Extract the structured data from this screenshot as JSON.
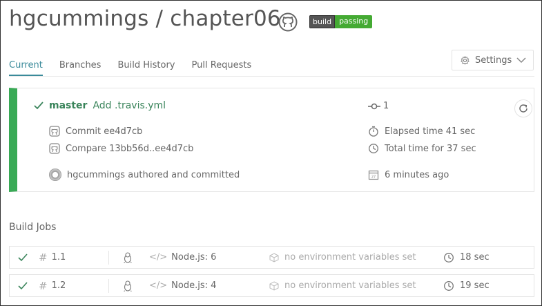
{
  "header": {
    "title": "hgcummings / chapter06",
    "badge_left": "build",
    "badge_right": "passing"
  },
  "tabs": [
    {
      "label": "Current",
      "active": true
    },
    {
      "label": "Branches",
      "active": false
    },
    {
      "label": "Build History",
      "active": false
    },
    {
      "label": "Pull Requests",
      "active": false
    }
  ],
  "settings_label": "Settings",
  "build": {
    "branch": "master",
    "message": "Add .travis.yml",
    "number": "1",
    "commit": "Commit ee4d7cb",
    "compare": "Compare 13bb56d..ee4d7cb",
    "author": "hgcummings authored and committed",
    "elapsed": "Elapsed time 41 sec",
    "total": "Total time for 37 sec",
    "ago": "6 minutes ago",
    "status_color": "#39aa56"
  },
  "jobs_title": "Build Jobs",
  "jobs": [
    {
      "number": "1.1",
      "env": "Node.js: 6",
      "vars": "no environment variables set",
      "duration": "18 sec"
    },
    {
      "number": "1.2",
      "env": "Node.js: 4",
      "vars": "no environment variables set",
      "duration": "19 sec"
    }
  ]
}
